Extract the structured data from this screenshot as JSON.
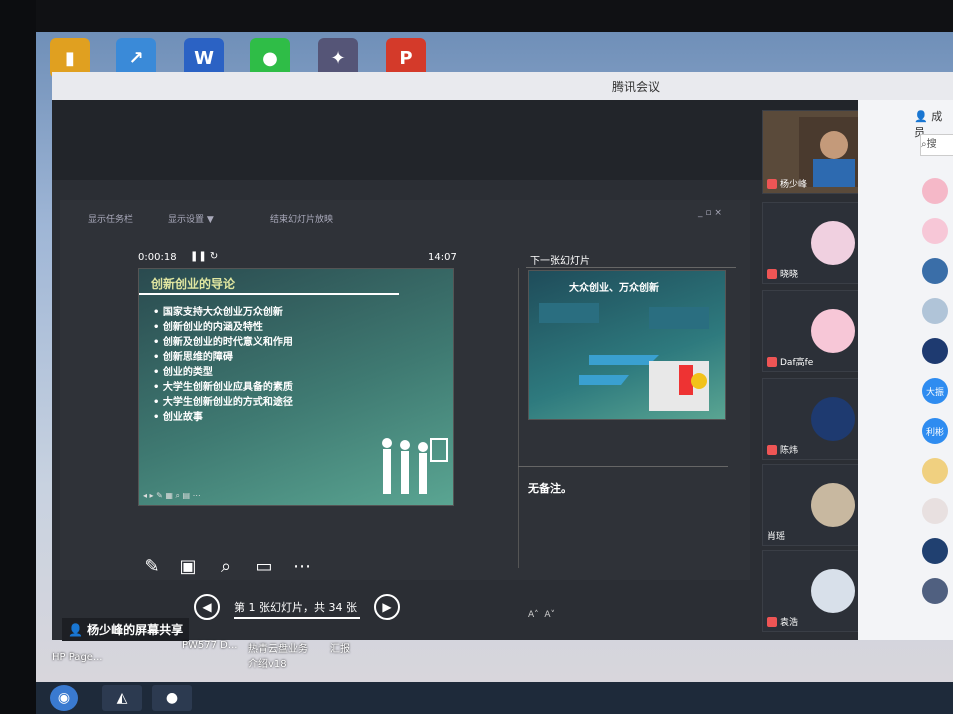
{
  "window": {
    "title": "腾讯会议"
  },
  "share": {
    "label": "杨少峰的屏幕共享",
    "toolbar": {
      "item1": "显示任务栏",
      "item2": "显示设置 ▼",
      "item3": "结束幻灯片放映"
    },
    "timer": "0:00:18",
    "clock": "14:07",
    "next_slide_label": "下一张幻灯片",
    "no_notes": "无备注。",
    "page_indicator": "第 1 张幻灯片，共 34 张"
  },
  "slide": {
    "title": "创新创业的导论",
    "bullets": [
      "国家支持大众创业万众创新",
      "创新创业的内涵及特性",
      "创新及创业的时代意义和作用",
      "创新思维的障碍",
      "创业的类型",
      "大学生创新创业应具备的素质",
      "大学生创新创业的方式和途径",
      "创业故事"
    ]
  },
  "next_slide": {
    "title": "大众创业、万众创新"
  },
  "participants": [
    {
      "name": "杨少峰"
    },
    {
      "name": "晓晓"
    },
    {
      "name": "Daf高fe"
    },
    {
      "name": "陈炜"
    },
    {
      "name": "肖瑶"
    },
    {
      "name": "袁浩"
    }
  ],
  "member_pane": {
    "title": "成员",
    "search": "搜",
    "avatar_texts": [
      "大振",
      "利彬"
    ]
  },
  "desktop": {
    "labels": [
      "HP Page...",
      "PW577 D...",
      "热青云盘业务介绍v18",
      "汇报"
    ]
  },
  "colors": {
    "accent": "#2f8cf0",
    "slide_teal": "#3f7a72"
  }
}
